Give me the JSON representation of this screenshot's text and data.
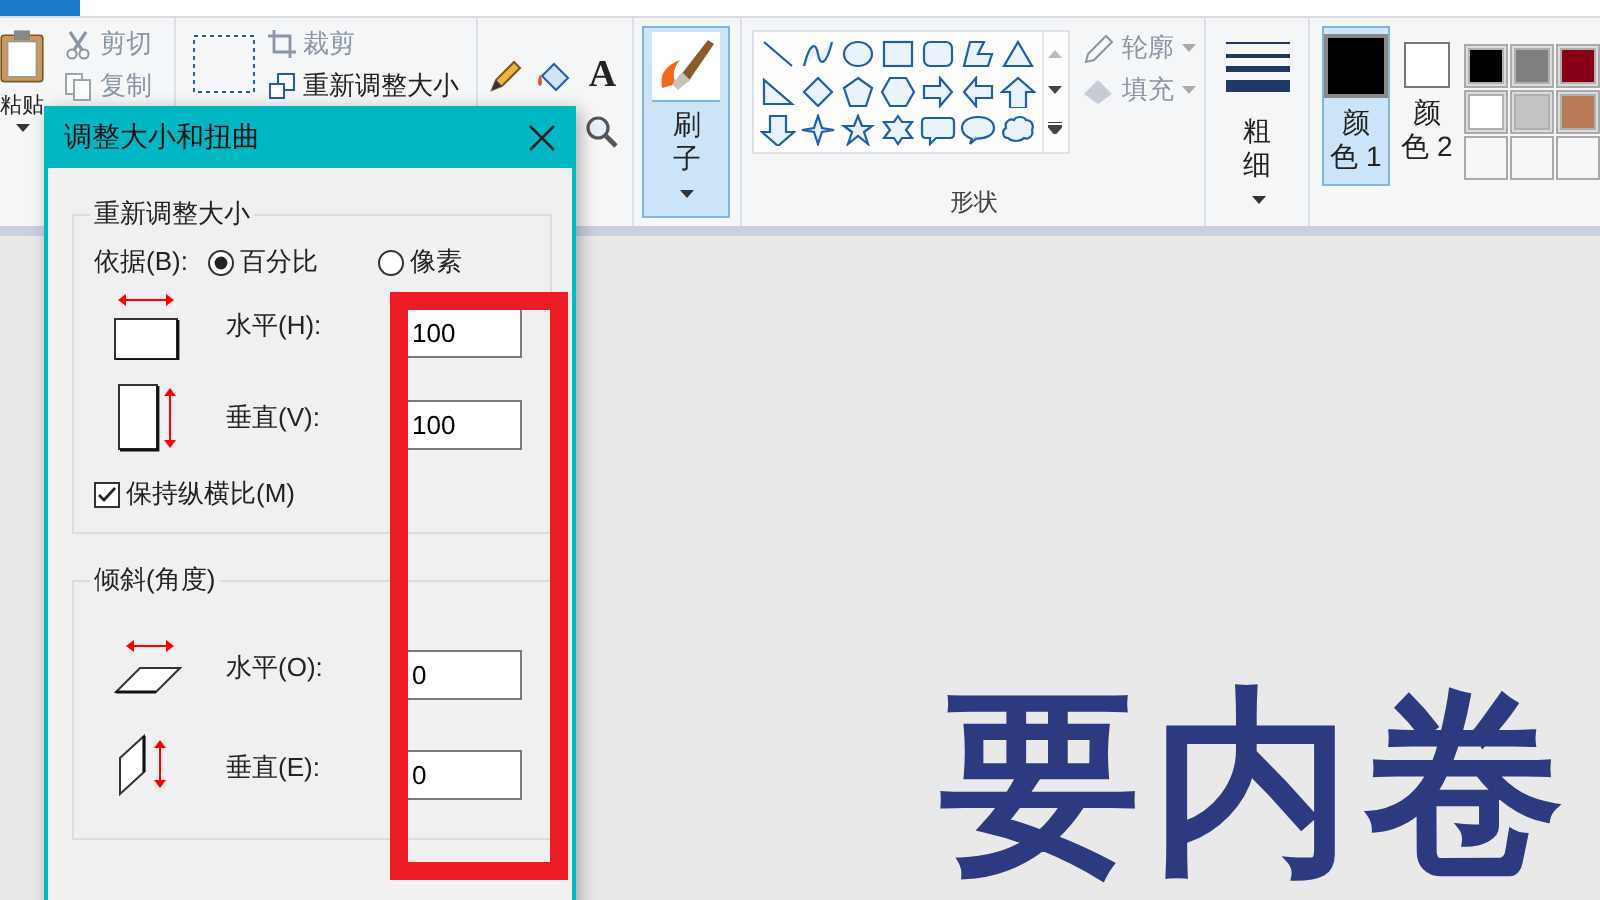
{
  "ribbon": {
    "clipboard": {
      "paste": "粘贴",
      "cut": "剪切",
      "copy": "复制"
    },
    "image": {
      "crop": "裁剪",
      "crop_disabled": true,
      "resize": "重新调整大小"
    },
    "tools": {
      "text_tool": "A"
    },
    "brushes": {
      "label": "刷子",
      "selected": true
    },
    "shapes": {
      "outline": "轮廓",
      "outline_disabled": true,
      "fill": "填充",
      "fill_disabled": true,
      "group_label": "形状"
    },
    "size": {
      "label": "粗细"
    },
    "colors": [
      {
        "label": "颜色 1",
        "selected": true,
        "color": "#000000"
      },
      {
        "label": "颜色 2",
        "selected": false,
        "color": "#ffffff"
      }
    ],
    "palette": [
      {
        "color": "#000000"
      },
      {
        "color": "#7f7f7f"
      },
      {
        "color": "#880015"
      },
      {
        "color": "#ffffff"
      },
      {
        "color": "#c3c3c3"
      },
      {
        "color": "#b97a57"
      }
    ]
  },
  "dialog": {
    "title": "调整大小和扭曲",
    "resize": {
      "legend": "重新调整大小",
      "by_label": "依据(B):",
      "radios": [
        {
          "label": "百分比",
          "selected": true
        },
        {
          "label": "像素",
          "selected": false
        }
      ],
      "fields": [
        {
          "kind": "horizontal",
          "label": "水平(H):",
          "value": "100"
        },
        {
          "kind": "vertical",
          "label": "垂直(V):",
          "value": "100"
        }
      ],
      "keep_ratio": {
        "label": "保持纵横比(M)",
        "checked": true
      }
    },
    "skew": {
      "legend": "倾斜(角度)",
      "fields": [
        {
          "kind": "skew-horizontal",
          "label": "水平(O):",
          "value": "0"
        },
        {
          "kind": "skew-vertical",
          "label": "垂直(E):",
          "value": "0"
        }
      ]
    }
  },
  "canvas": {
    "text": "要内卷"
  }
}
